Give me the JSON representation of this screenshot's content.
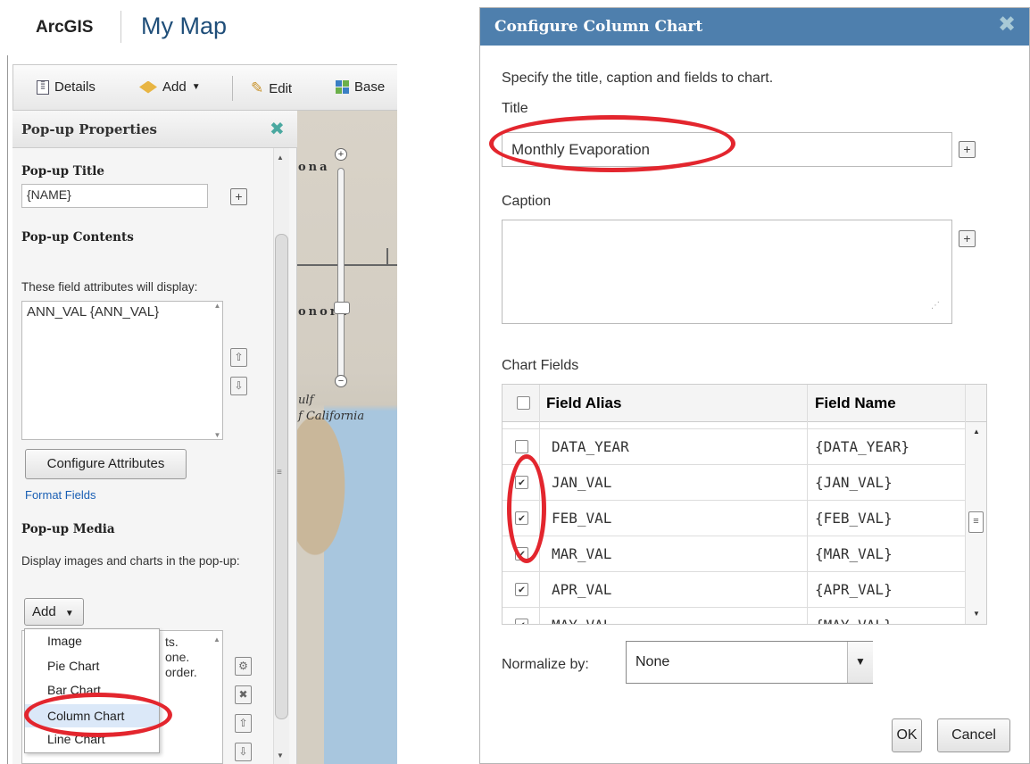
{
  "header": {
    "brand": "ArcGIS",
    "map_title": "My Map"
  },
  "toolbar": {
    "details": "Details",
    "add": "Add",
    "edit": "Edit",
    "basemap": "Base"
  },
  "popup_panel": {
    "title": "Pop-up Properties",
    "popup_title_label": "Pop-up Title",
    "popup_title_value": "{NAME}",
    "contents_label": "Pop-up Contents",
    "attributes_text": "These field attributes will display:",
    "attributes_value": "ANN_VAL {ANN_VAL}",
    "configure_button": "Configure Attributes",
    "format_fields_link": "Format Fields",
    "media_label": "Pop-up Media",
    "media_desc": "Display images and charts in the pop-up:",
    "add_button": "Add",
    "media_list_lines": [
      "ts.",
      "one.",
      "order."
    ],
    "menu_items": [
      "Image",
      "Pie Chart",
      "Bar Chart",
      "Column Chart",
      "Line Chart"
    ],
    "selected_menu_item": "Column Chart"
  },
  "map": {
    "labels": [
      "ona",
      "onora",
      "ulf",
      "f California"
    ]
  },
  "dialog": {
    "title": "Configure Column Chart",
    "instruction": "Specify the title, caption and fields to chart.",
    "title_label": "Title",
    "title_value": "Monthly Evaporation",
    "caption_label": "Caption",
    "caption_value": "",
    "chart_fields_label": "Chart Fields",
    "columns": [
      "Field Alias",
      "Field Name"
    ],
    "rows": [
      {
        "alias": "DATA_YEAR",
        "name": "{DATA_YEAR}",
        "checked": false
      },
      {
        "alias": "JAN_VAL",
        "name": "{JAN_VAL}",
        "checked": true
      },
      {
        "alias": "FEB_VAL",
        "name": "{FEB_VAL}",
        "checked": true
      },
      {
        "alias": "MAR_VAL",
        "name": "{MAR_VAL}",
        "checked": true
      },
      {
        "alias": "APR_VAL",
        "name": "{APR_VAL}",
        "checked": true
      },
      {
        "alias": "MAY_VAL",
        "name": "{MAY_VAL}",
        "checked": true
      }
    ],
    "normalize_label": "Normalize by:",
    "normalize_value": "None",
    "ok_button": "OK",
    "cancel_button": "Cancel"
  },
  "colors": {
    "dialog_header": "#4e7fad",
    "highlight": "#e3262e",
    "link": "#1a5fb4"
  }
}
